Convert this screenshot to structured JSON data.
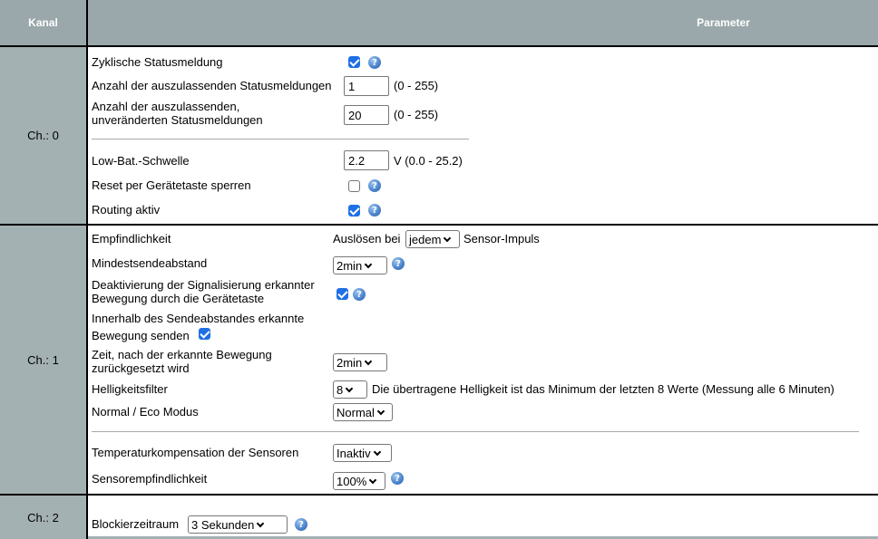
{
  "header": {
    "kanal": "Kanal",
    "parameter": "Parameter"
  },
  "ch0": {
    "label": "Ch.: 0",
    "zyklisch_label": "Zyklische Statusmeldung",
    "zyklisch_checked": true,
    "anzahl_label": "Anzahl der auszulassenden Statusmeldungen",
    "anzahl_value": "1",
    "anzahl_range": "(0 - 255)",
    "unver_label_1": "Anzahl der auszulassenden,",
    "unver_label_2": "unveränderten Statusmeldungen",
    "unver_value": "20",
    "unver_range": "(0 - 255)",
    "lowbat_label": "Low-Bat.-Schwelle",
    "lowbat_value": "2.2",
    "lowbat_range": "V (0.0 - 25.2)",
    "reset_label": "Reset per Gerätetaste sperren",
    "reset_checked": false,
    "routing_label": "Routing aktiv",
    "routing_checked": true
  },
  "ch1": {
    "label": "Ch.: 1",
    "empf_label": "Empfindlichkeit",
    "empf_prefix": "Auslösen bei",
    "empf_select": "jedem",
    "empf_suffix": "Sensor-Impuls",
    "mindest_label": "Mindestsendeabstand",
    "mindest_select": "2min",
    "deakt_label_1": "Deaktivierung der Signalisierung erkannter",
    "deakt_label_2": "Bewegung durch die Gerätetaste",
    "deakt_checked": true,
    "innerhalb_label_1": "Innerhalb des Sendeabstandes erkannte",
    "innerhalb_label_2": "Bewegung senden",
    "innerhalb_checked": true,
    "zeit_label_1": "Zeit, nach der erkannte Bewegung",
    "zeit_label_2": "zurückgesetzt wird",
    "zeit_select": "2min",
    "hell_label": "Helligkeitsfilter",
    "hell_select": "8",
    "hell_desc": "Die übertragene Helligkeit ist das Minimum der letzten 8 Werte (Messung alle 6 Minuten)",
    "eco_label": "Normal / Eco Modus",
    "eco_select": "Normal",
    "temp_label": "Temperaturkompensation der Sensoren",
    "temp_select": "Inaktiv",
    "sensor_label": "Sensorempfindlichkeit",
    "sensor_select": "100%"
  },
  "ch2": {
    "label": "Ch.: 2",
    "block_label": "Blockierzeitraum",
    "block_select": "3 Sekunden"
  },
  "colors": {
    "header_bg": "#9aa8ab",
    "kanal_bg": "#a4b1b3",
    "checkbox_blue": "#1f6fe5"
  },
  "icons": {
    "help": "help-icon",
    "checkbox": "checkbox",
    "dropdown": "chevron-down-icon"
  }
}
